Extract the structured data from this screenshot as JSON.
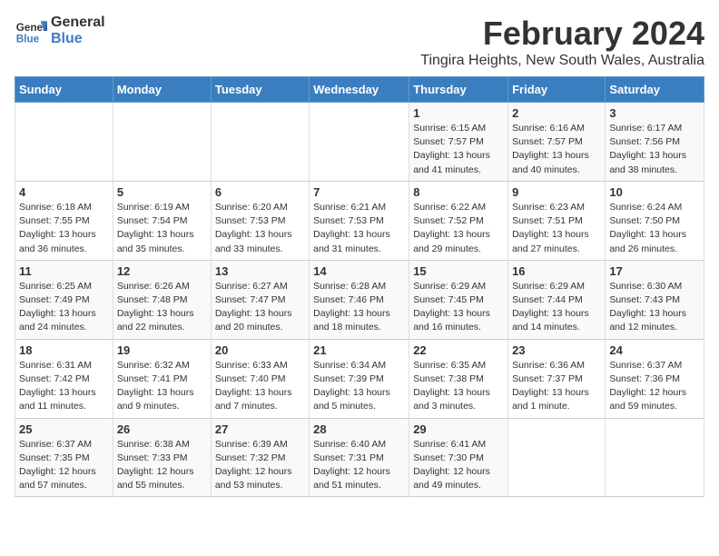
{
  "logo": {
    "name_part1": "General",
    "name_part2": "Blue"
  },
  "header": {
    "title": "February 2024",
    "subtitle": "Tingira Heights, New South Wales, Australia"
  },
  "calendar": {
    "columns": [
      "Sunday",
      "Monday",
      "Tuesday",
      "Wednesday",
      "Thursday",
      "Friday",
      "Saturday"
    ],
    "weeks": [
      [
        {
          "day": "",
          "info": ""
        },
        {
          "day": "",
          "info": ""
        },
        {
          "day": "",
          "info": ""
        },
        {
          "day": "",
          "info": ""
        },
        {
          "day": "1",
          "info": "Sunrise: 6:15 AM\nSunset: 7:57 PM\nDaylight: 13 hours\nand 41 minutes."
        },
        {
          "day": "2",
          "info": "Sunrise: 6:16 AM\nSunset: 7:57 PM\nDaylight: 13 hours\nand 40 minutes."
        },
        {
          "day": "3",
          "info": "Sunrise: 6:17 AM\nSunset: 7:56 PM\nDaylight: 13 hours\nand 38 minutes."
        }
      ],
      [
        {
          "day": "4",
          "info": "Sunrise: 6:18 AM\nSunset: 7:55 PM\nDaylight: 13 hours\nand 36 minutes."
        },
        {
          "day": "5",
          "info": "Sunrise: 6:19 AM\nSunset: 7:54 PM\nDaylight: 13 hours\nand 35 minutes."
        },
        {
          "day": "6",
          "info": "Sunrise: 6:20 AM\nSunset: 7:53 PM\nDaylight: 13 hours\nand 33 minutes."
        },
        {
          "day": "7",
          "info": "Sunrise: 6:21 AM\nSunset: 7:53 PM\nDaylight: 13 hours\nand 31 minutes."
        },
        {
          "day": "8",
          "info": "Sunrise: 6:22 AM\nSunset: 7:52 PM\nDaylight: 13 hours\nand 29 minutes."
        },
        {
          "day": "9",
          "info": "Sunrise: 6:23 AM\nSunset: 7:51 PM\nDaylight: 13 hours\nand 27 minutes."
        },
        {
          "day": "10",
          "info": "Sunrise: 6:24 AM\nSunset: 7:50 PM\nDaylight: 13 hours\nand 26 minutes."
        }
      ],
      [
        {
          "day": "11",
          "info": "Sunrise: 6:25 AM\nSunset: 7:49 PM\nDaylight: 13 hours\nand 24 minutes."
        },
        {
          "day": "12",
          "info": "Sunrise: 6:26 AM\nSunset: 7:48 PM\nDaylight: 13 hours\nand 22 minutes."
        },
        {
          "day": "13",
          "info": "Sunrise: 6:27 AM\nSunset: 7:47 PM\nDaylight: 13 hours\nand 20 minutes."
        },
        {
          "day": "14",
          "info": "Sunrise: 6:28 AM\nSunset: 7:46 PM\nDaylight: 13 hours\nand 18 minutes."
        },
        {
          "day": "15",
          "info": "Sunrise: 6:29 AM\nSunset: 7:45 PM\nDaylight: 13 hours\nand 16 minutes."
        },
        {
          "day": "16",
          "info": "Sunrise: 6:29 AM\nSunset: 7:44 PM\nDaylight: 13 hours\nand 14 minutes."
        },
        {
          "day": "17",
          "info": "Sunrise: 6:30 AM\nSunset: 7:43 PM\nDaylight: 13 hours\nand 12 minutes."
        }
      ],
      [
        {
          "day": "18",
          "info": "Sunrise: 6:31 AM\nSunset: 7:42 PM\nDaylight: 13 hours\nand 11 minutes."
        },
        {
          "day": "19",
          "info": "Sunrise: 6:32 AM\nSunset: 7:41 PM\nDaylight: 13 hours\nand 9 minutes."
        },
        {
          "day": "20",
          "info": "Sunrise: 6:33 AM\nSunset: 7:40 PM\nDaylight: 13 hours\nand 7 minutes."
        },
        {
          "day": "21",
          "info": "Sunrise: 6:34 AM\nSunset: 7:39 PM\nDaylight: 13 hours\nand 5 minutes."
        },
        {
          "day": "22",
          "info": "Sunrise: 6:35 AM\nSunset: 7:38 PM\nDaylight: 13 hours\nand 3 minutes."
        },
        {
          "day": "23",
          "info": "Sunrise: 6:36 AM\nSunset: 7:37 PM\nDaylight: 13 hours\nand 1 minute."
        },
        {
          "day": "24",
          "info": "Sunrise: 6:37 AM\nSunset: 7:36 PM\nDaylight: 12 hours\nand 59 minutes."
        }
      ],
      [
        {
          "day": "25",
          "info": "Sunrise: 6:37 AM\nSunset: 7:35 PM\nDaylight: 12 hours\nand 57 minutes."
        },
        {
          "day": "26",
          "info": "Sunrise: 6:38 AM\nSunset: 7:33 PM\nDaylight: 12 hours\nand 55 minutes."
        },
        {
          "day": "27",
          "info": "Sunrise: 6:39 AM\nSunset: 7:32 PM\nDaylight: 12 hours\nand 53 minutes."
        },
        {
          "day": "28",
          "info": "Sunrise: 6:40 AM\nSunset: 7:31 PM\nDaylight: 12 hours\nand 51 minutes."
        },
        {
          "day": "29",
          "info": "Sunrise: 6:41 AM\nSunset: 7:30 PM\nDaylight: 12 hours\nand 49 minutes."
        },
        {
          "day": "",
          "info": ""
        },
        {
          "day": "",
          "info": ""
        }
      ]
    ]
  }
}
